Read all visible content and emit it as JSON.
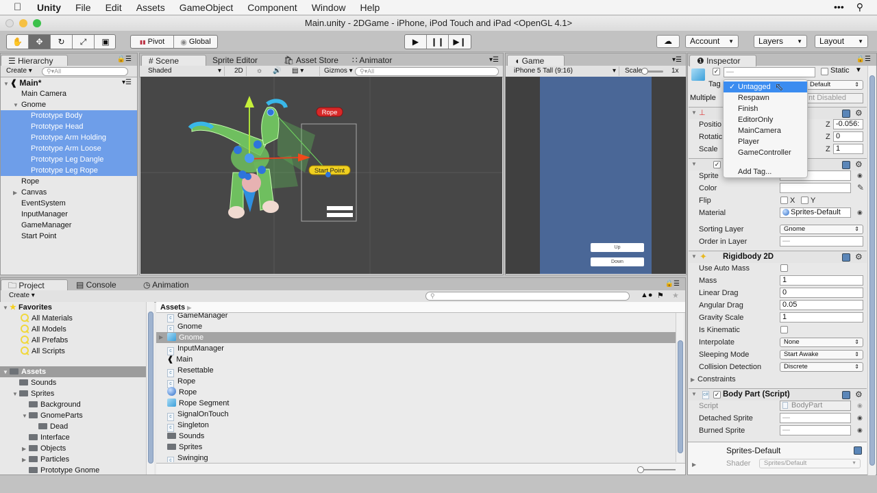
{
  "menubar": {
    "app": "Unity",
    "items": [
      "File",
      "Edit",
      "Assets",
      "GameObject",
      "Component",
      "Window",
      "Help"
    ]
  },
  "window": {
    "title": "Main.unity - 2DGame - iPhone, iPod Touch and iPad <OpenGL 4.1>"
  },
  "toolbar": {
    "pivot_label": "Pivot",
    "global_label": "Global",
    "account_label": "Account",
    "layers_label": "Layers",
    "layout_label": "Layout"
  },
  "hierarchy": {
    "tab": "Hierarchy",
    "create": "Create",
    "search_placeholder": "All",
    "scene": "Main*",
    "items": [
      {
        "label": "Main Camera",
        "level": 1,
        "selected": false
      },
      {
        "label": "Gnome",
        "level": 1,
        "expanded": true,
        "selected": false
      },
      {
        "label": "Prototype Body",
        "level": 2,
        "selected": true
      },
      {
        "label": "Prototype Head",
        "level": 2,
        "selected": true
      },
      {
        "label": "Prototype Arm Holding",
        "level": 2,
        "selected": true
      },
      {
        "label": "Prototype Arm Loose",
        "level": 2,
        "selected": true
      },
      {
        "label": "Prototype Leg Dangle",
        "level": 2,
        "selected": true
      },
      {
        "label": "Prototype Leg Rope",
        "level": 2,
        "selected": true
      },
      {
        "label": "Rope",
        "level": 1,
        "selected": false
      },
      {
        "label": "Canvas",
        "level": 1,
        "collapsed": true,
        "selected": false
      },
      {
        "label": "EventSystem",
        "level": 1,
        "selected": false
      },
      {
        "label": "InputManager",
        "level": 1,
        "selected": false
      },
      {
        "label": "GameManager",
        "level": 1,
        "selected": false
      },
      {
        "label": "Start Point",
        "level": 1,
        "selected": false
      }
    ]
  },
  "scene": {
    "tabs": [
      "Scene",
      "Sprite Editor",
      "Asset Store",
      "Animator"
    ],
    "shading": "Shaded",
    "mode_2d": "2D",
    "gizmos": "Gizmos",
    "search_placeholder": "All",
    "labels": {
      "rope": "Rope",
      "start_point": "Start Point"
    }
  },
  "game": {
    "tab": "Game",
    "aspect": "iPhone 5 Tall (9:16)",
    "scale_label": "Scale",
    "scale_value": "1x",
    "buttons": [
      "Up",
      "Down"
    ]
  },
  "inspector": {
    "tab": "Inspector",
    "name_value": "—",
    "static_label": "Static",
    "tag_label": "Tag",
    "layer_value": "Default",
    "multiple_label": "Multiple",
    "multiple_value": "nt Disabled",
    "tag_menu": {
      "items": [
        "Untagged",
        "Respawn",
        "Finish",
        "EditorOnly",
        "MainCamera",
        "Player",
        "GameController"
      ],
      "selected": "Untagged",
      "add": "Add Tag..."
    },
    "transform": {
      "rows": [
        {
          "label": "Positio",
          "z": "-0.056:"
        },
        {
          "label": "Rotatic",
          "z": "0"
        },
        {
          "label": "Scale",
          "z": "1"
        }
      ],
      "z_label": "Z"
    },
    "sprite_renderer": {
      "sprite_label": "Sprite",
      "color_label": "Color",
      "flip_label": "Flip",
      "flip_x": "X",
      "flip_y": "Y",
      "material_label": "Material",
      "material_value": "Sprites-Default",
      "sorting_layer_label": "Sorting Layer",
      "sorting_layer_value": "Gnome",
      "order_label": "Order in Layer",
      "order_value": "—"
    },
    "rigidbody": {
      "title": "Rigidbody 2D",
      "use_auto_mass": "Use Auto Mass",
      "mass_label": "Mass",
      "mass": "1",
      "linear_drag_label": "Linear Drag",
      "linear_drag": "0",
      "angular_drag_label": "Angular Drag",
      "angular_drag": "0.05",
      "gravity_label": "Gravity Scale",
      "gravity": "1",
      "kinematic_label": "Is Kinematic",
      "interpolate_label": "Interpolate",
      "interpolate": "None",
      "sleeping_label": "Sleeping Mode",
      "sleeping": "Start Awake",
      "collision_label": "Collision Detection",
      "collision": "Discrete",
      "constraints_label": "Constraints"
    },
    "body_part": {
      "title": "Body Part (Script)",
      "script_label": "Script",
      "script_value": "BodyPart",
      "detached_label": "Detached Sprite",
      "detached_value": "—",
      "burned_label": "Burned Sprite",
      "burned_value": "—"
    },
    "material": {
      "name": "Sprites-Default",
      "shader_label": "Shader",
      "shader_value": "Sprites/Default"
    }
  },
  "project": {
    "tabs": [
      "Project",
      "Console",
      "Animation"
    ],
    "create": "Create",
    "favorites_label": "Favorites",
    "favorites": [
      "All Materials",
      "All Models",
      "All Prefabs",
      "All Scripts"
    ],
    "assets_label": "Assets",
    "tree": [
      {
        "label": "Sounds",
        "level": 1
      },
      {
        "label": "Sprites",
        "level": 1,
        "expanded": true
      },
      {
        "label": "Background",
        "level": 2
      },
      {
        "label": "GnomeParts",
        "level": 2,
        "expanded": true
      },
      {
        "label": "Dead",
        "level": 3
      },
      {
        "label": "Interface",
        "level": 2
      },
      {
        "label": "Objects",
        "level": 2,
        "collapsed": true
      },
      {
        "label": "Particles",
        "level": 2,
        "collapsed": true
      },
      {
        "label": "Prototype Gnome",
        "level": 2
      }
    ],
    "breadcrumb": "Assets",
    "files": [
      {
        "label": "GameManager",
        "type": "script"
      },
      {
        "label": "Gnome",
        "type": "script"
      },
      {
        "label": "Gnome",
        "type": "prefab",
        "selected": true
      },
      {
        "label": "InputManager",
        "type": "script"
      },
      {
        "label": "Main",
        "type": "scene"
      },
      {
        "label": "Resettable",
        "type": "script"
      },
      {
        "label": "Rope",
        "type": "script"
      },
      {
        "label": "Rope",
        "type": "material"
      },
      {
        "label": "Rope Segment",
        "type": "prefab"
      },
      {
        "label": "SignalOnTouch",
        "type": "script"
      },
      {
        "label": "Singleton",
        "type": "script"
      },
      {
        "label": "Sounds",
        "type": "folder"
      },
      {
        "label": "Sprites",
        "type": "folder"
      },
      {
        "label": "Swinging",
        "type": "script"
      }
    ]
  }
}
